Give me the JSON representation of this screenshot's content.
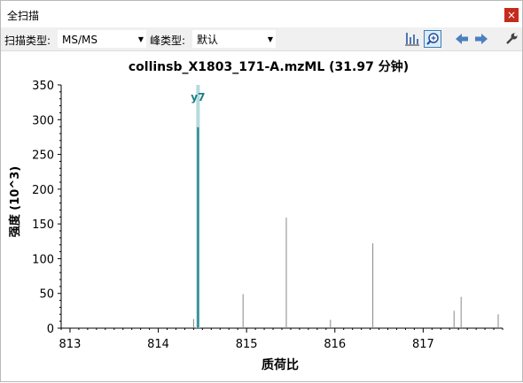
{
  "window": {
    "title": "全扫描",
    "close_glyph": "×"
  },
  "toolbar": {
    "scan_type_label": "扫描类型:",
    "scan_type_value": "MS/MS",
    "peak_type_label": "峰类型:",
    "peak_type_value": "默认",
    "buttons": [
      "bar-chart-icon",
      "zoom-icon",
      "back-arrow-icon",
      "forward-arrow-icon",
      "settings-wrench-icon"
    ]
  },
  "colors": {
    "highlight_peak": "#1a7f86",
    "highlight_halo": "#b6dadd",
    "peaks": "#888888",
    "close": "#c42b1c"
  },
  "chart_data": {
    "type": "bar",
    "title": "collinsb_X1803_171-A.mzML (31.97 分钟)",
    "xlabel": "质荷比",
    "ylabel": "强度 (10^3)",
    "xlim": [
      812.9,
      817.9
    ],
    "ylim": [
      0,
      350
    ],
    "x_ticks": [
      813,
      814,
      815,
      816,
      817
    ],
    "y_ticks": [
      0,
      50,
      100,
      150,
      200,
      250,
      300,
      350
    ],
    "annotation": "y7",
    "highlighted": {
      "x": 814.45,
      "value": 289,
      "label": "y7"
    },
    "peaks": [
      {
        "x": 813.45,
        "value": 1.5
      },
      {
        "x": 814.4,
        "value": 13
      },
      {
        "x": 814.96,
        "value": 49
      },
      {
        "x": 815.45,
        "value": 159
      },
      {
        "x": 815.95,
        "value": 12
      },
      {
        "x": 816.43,
        "value": 122
      },
      {
        "x": 817.35,
        "value": 25
      },
      {
        "x": 817.43,
        "value": 45
      },
      {
        "x": 817.85,
        "value": 20
      }
    ]
  }
}
